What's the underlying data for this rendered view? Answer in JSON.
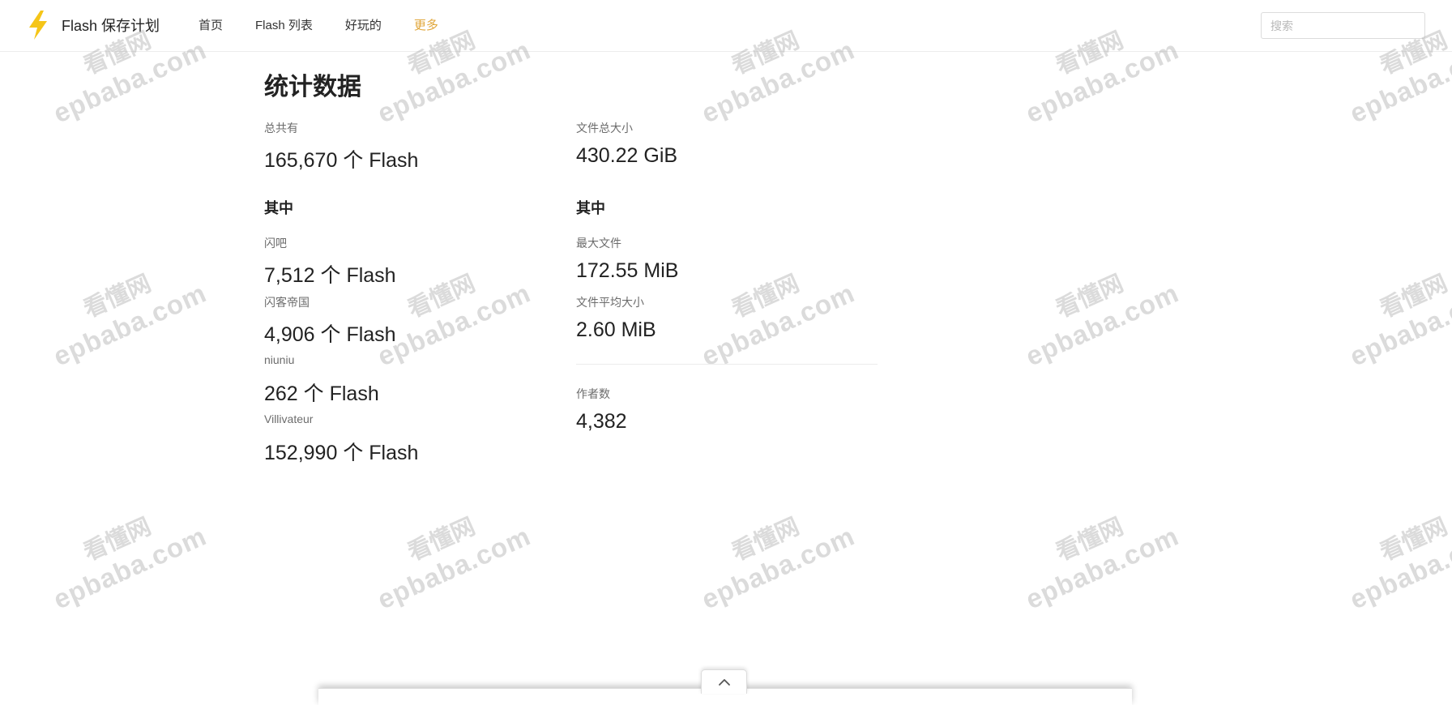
{
  "navbar": {
    "brand_text": "Flash 保存计划",
    "links": [
      "首页",
      "Flash 列表",
      "好玩的",
      "更多"
    ],
    "active_link": "更多",
    "active_color": "#e0a63a",
    "brand_icon": "lightning-bolt-icon",
    "brand_icon_color": "#f5c518",
    "search_placeholder": "搜索"
  },
  "page": {
    "title": "统计数据",
    "left": {
      "total_label": "总共有",
      "total_value": "165,670 个 Flash",
      "breakdown_heading": "其中",
      "sources": [
        {
          "label": "闪吧",
          "value": "7,512 个 Flash"
        },
        {
          "label": "闪客帝国",
          "value": "4,906 个 Flash"
        },
        {
          "label": "niuniu",
          "value": "262 个 Flash"
        },
        {
          "label": "Villivateur",
          "value": "152,990 个 Flash"
        }
      ]
    },
    "right": {
      "size_label": "文件总大小",
      "size_value": "430.22 GiB",
      "breakdown_heading": "其中",
      "largest_label": "最大文件",
      "largest_value": "172.55 MiB",
      "average_label": "文件平均大小",
      "average_value": "2.60 MiB",
      "authors_label": "作者数",
      "authors_value": "4,382"
    }
  },
  "watermark": {
    "line1": "看懂网",
    "line2": "epbaba.com"
  },
  "bottom_toggle": {
    "icon": "chevron-up-icon"
  }
}
